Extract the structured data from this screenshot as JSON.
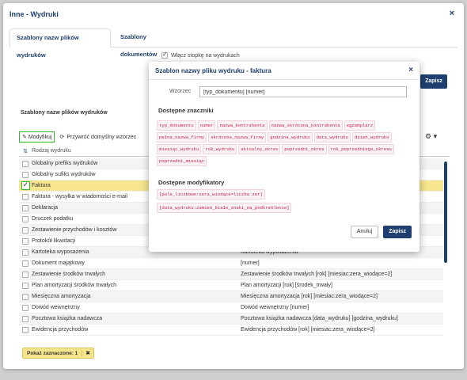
{
  "window": {
    "title": "Inne - Wydruki",
    "close": "×"
  },
  "tabs": [
    {
      "label": "Szablony nazw plików wydruków",
      "active": true
    },
    {
      "label": "Szablony dokumentów",
      "active": false
    }
  ],
  "footer_checkbox": {
    "label": "Włącz stopkę na wydrukach",
    "checked": true
  },
  "background_save": "Zapisz",
  "section_label": "Szablony nazw plików wydruków",
  "toolbar": {
    "modify_label": "Modyfikuj",
    "reset_label": "Przywróć domyślny wzorzec"
  },
  "table": {
    "header": {
      "name": "Rodzaj wydruku"
    },
    "rows": [
      {
        "name": "Globalny prefiks wydruków",
        "pattern": ""
      },
      {
        "name": "Globalny sufiks wydruków",
        "pattern": ""
      },
      {
        "name": "Faktura",
        "pattern": ""
      },
      {
        "name": "Faktura - wysyłka w wiadomości e-mail",
        "pattern": ""
      },
      {
        "name": "Deklaracja",
        "pattern": ""
      },
      {
        "name": "Druczek podatku",
        "pattern": ""
      },
      {
        "name": "Zestawienie przychodów i kosztów",
        "pattern": ""
      },
      {
        "name": "Protokół likwidacji",
        "pattern": ""
      },
      {
        "name": "Kartoteka wyposażenia",
        "pattern": "Kartoteka wyposażenia"
      },
      {
        "name": "Dokument majątkowy",
        "pattern": "[numer]"
      },
      {
        "name": "Zestawienie środków trwałych",
        "pattern": "Zestawienie środków trwałych [rok] [miesiac:zera_wiodące=2]"
      },
      {
        "name": "Plan amortyzacji środków trwałych",
        "pattern": "Plan amortyzacji [rok] [środek_trwały]"
      },
      {
        "name": "Miesięczna amortyzacja",
        "pattern": "Miesięczna amortyzacja [rok] [miesiac:zera_wiodące=2]"
      },
      {
        "name": "Dowód wewnętrzny",
        "pattern": "Dowód wewnętrzny [numer]"
      },
      {
        "name": "Pocztowa książka nadawcza",
        "pattern": "Pocztowa książka nadawcza [data_wydruku] [godzina_wydruku]"
      },
      {
        "name": "Ewidencja przychodów",
        "pattern": "Ewidencja przychodów [rok] [miesiac:zera_wiodące=2]"
      }
    ],
    "selected_index": 2
  },
  "selection_pill": {
    "label": "Pokaż zaznaczone: 1",
    "clear": "✖"
  },
  "modal": {
    "title": "Szablon nazwy pliku wydruku - faktura",
    "close": "×",
    "pattern_label": "Wzorzec",
    "pattern_value": "[typ_dokumentu] [numer]",
    "markers_heading": "Dostępne znaczniki",
    "markers": [
      "typ_dokumentu",
      "numer",
      "nazwa_kontrahenta",
      "nazwa_skrócona_kontrahenta",
      "egzemplarz",
      "pełna_nazwa_firmy",
      "skrócona_nazwa_firmy",
      "godzina_wydruku",
      "data_wydruku",
      "dzień_wydruku",
      "miesiąc_wydruku",
      "rok_wydruku",
      "aktualny_okres",
      "poprzedni_okres",
      "rok_poprzedniego_okresu",
      "poprzedni_miesiąc"
    ],
    "modifiers_heading": "Dostępne modyfikatory",
    "modifiers": [
      "[pole_liczbowe:zera_wiodące=liczba zer]",
      "[data_wydruku:zamień_białe_znaki_na_podkreślenie]"
    ],
    "cancel_label": "Anuluj",
    "save_label": "Zapisz"
  },
  "colors": {
    "accent": "#1e3f6f",
    "selected_row": "#f6e58d",
    "highlight_border": "#2eb82e",
    "tag_text": "#c7254e"
  }
}
